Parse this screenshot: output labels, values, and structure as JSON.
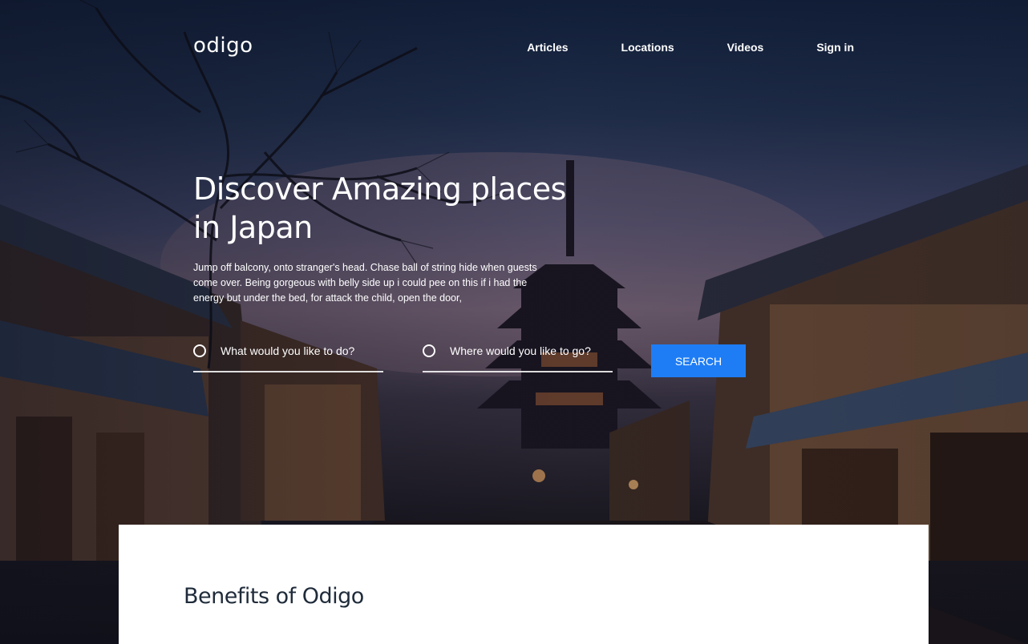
{
  "brand": {
    "logo_text": "odigo"
  },
  "nav": {
    "items": [
      {
        "label": "Articles"
      },
      {
        "label": "Locations"
      },
      {
        "label": "Videos"
      },
      {
        "label": "Sign in"
      }
    ]
  },
  "hero": {
    "title": "Discover Amazing places in Japan",
    "description": "Jump off balcony, onto stranger's head. Chase ball of string hide when guests come over. Being gorgeous with belly side up i could pee on this if i had the energy but under the bed, for attack the child, open the door,"
  },
  "search": {
    "activity_placeholder": "What would you like to do?",
    "location_placeholder": "Where would you like to go?",
    "button_label": "SEARCH"
  },
  "benefits": {
    "title": "Benefits of Odigo"
  },
  "colors": {
    "accent": "#1e7df5",
    "panel": "#ffffff",
    "heading_dark": "#1f2b3a"
  }
}
